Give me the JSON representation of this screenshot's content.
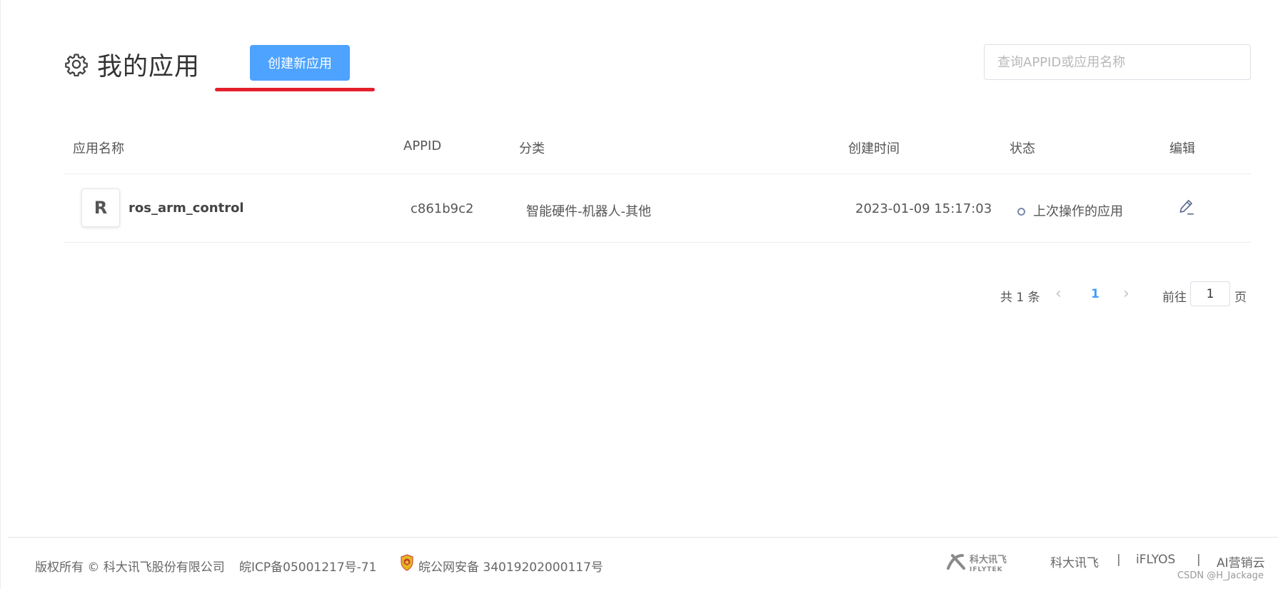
{
  "header": {
    "title": "我的应用",
    "create_button": "创建新应用",
    "search_placeholder": "查询APPID或应用名称"
  },
  "table": {
    "columns": [
      "应用名称",
      "APPID",
      "分类",
      "创建时间",
      "状态",
      "编辑"
    ],
    "rows": [
      {
        "avatar_letter": "R",
        "name": "ros_arm_control",
        "appid": "c861b9c2",
        "category": "智能硬件-机器人-其他",
        "created": "2023-01-09 15:17:03",
        "status": "上次操作的应用"
      }
    ]
  },
  "pagination": {
    "total": "共 1 条",
    "current": "1",
    "goto_label": "前往",
    "goto_value": "1",
    "page_suffix": "页"
  },
  "footer": {
    "copyright": "版权所有 © 科大讯飞股份有限公司",
    "icp": "皖ICP备05001217号-71",
    "police": "皖公网安备 34019202000117号",
    "logo_text": "科大讯飞",
    "logo_sub": "IFLYTEK",
    "links": [
      "科大讯飞",
      "iFLYOS",
      "AI营销云"
    ],
    "separator": "|"
  },
  "watermark": "CSDN @H_Jackage",
  "colors": {
    "primary": "#4da3ff",
    "highlight": "#e3202b",
    "link_active": "#409eff"
  }
}
